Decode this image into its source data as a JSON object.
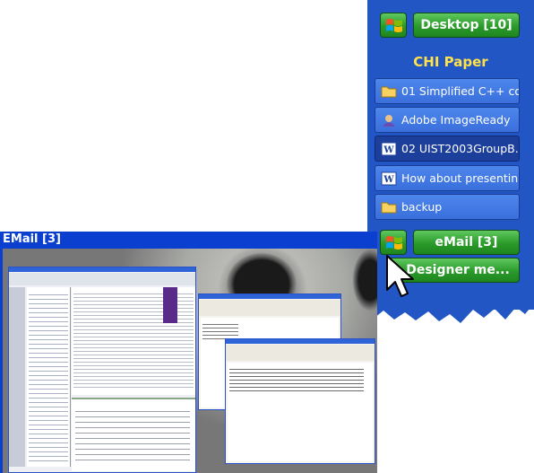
{
  "desktop_button": {
    "label": "Desktop [10]"
  },
  "group": {
    "title": "CHI Paper"
  },
  "items": [
    {
      "label": "01 Simplified C++ co...",
      "icon": "folder-icon",
      "active": false
    },
    {
      "label": "Adobe ImageReady",
      "icon": "imageready-icon",
      "active": false
    },
    {
      "label": "02 UIST2003GroupB...",
      "icon": "word-icon",
      "active": true
    },
    {
      "label": "How about presentin...",
      "icon": "word-icon",
      "active": false
    },
    {
      "label": "backup",
      "icon": "folder-icon",
      "active": false
    }
  ],
  "email_button": {
    "label": "eMail [3]"
  },
  "designer_button": {
    "label": "Designer me..."
  },
  "email_window": {
    "title": "EMail [3]"
  },
  "colors": {
    "panel": "#2156c4",
    "button_green": "#2a9a2a",
    "group_title": "#ffe14a",
    "window_title": "#0b3fcf"
  }
}
